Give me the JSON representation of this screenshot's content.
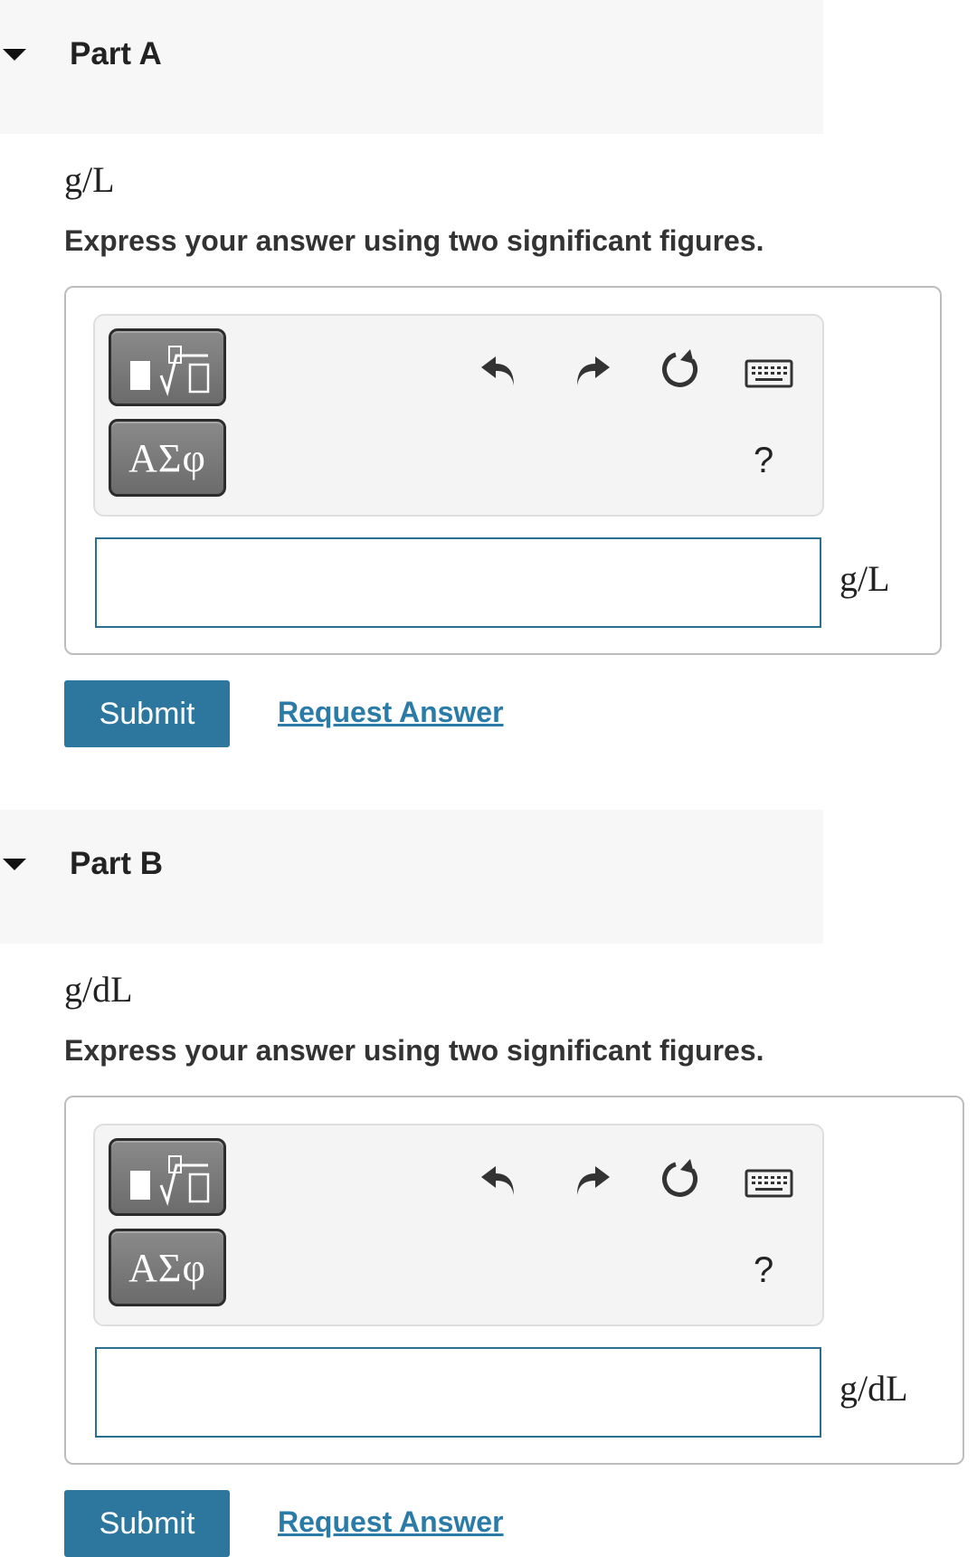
{
  "parts": [
    {
      "title": "Part A",
      "unit_label": "g/L",
      "instruction": "Express your answer using two significant figures.",
      "toolbar": {
        "templates_icon": "fraction-root-templates-icon",
        "greek_label": "ΑΣφ",
        "undo_icon": "undo-icon",
        "redo_icon": "redo-icon",
        "reset_icon": "reset-icon",
        "keyboard_icon": "keyboard-icon",
        "help_label": "?"
      },
      "input_value": "",
      "input_unit": "g/L",
      "submit_label": "Submit",
      "request_label": "Request Answer"
    },
    {
      "title": "Part B",
      "unit_label": "g/dL",
      "instruction": "Express your answer using two significant figures.",
      "toolbar": {
        "templates_icon": "fraction-root-templates-icon",
        "greek_label": "ΑΣφ",
        "undo_icon": "undo-icon",
        "redo_icon": "redo-icon",
        "reset_icon": "reset-icon",
        "keyboard_icon": "keyboard-icon",
        "help_label": "?"
      },
      "input_value": "",
      "input_unit": "g/dL",
      "submit_label": "Submit",
      "request_label": "Request Answer"
    }
  ],
  "colors": {
    "accent": "#2d779f",
    "link": "#2a7ba8",
    "input_border": "#2a6f92",
    "header_bg": "#f7f7f7"
  }
}
